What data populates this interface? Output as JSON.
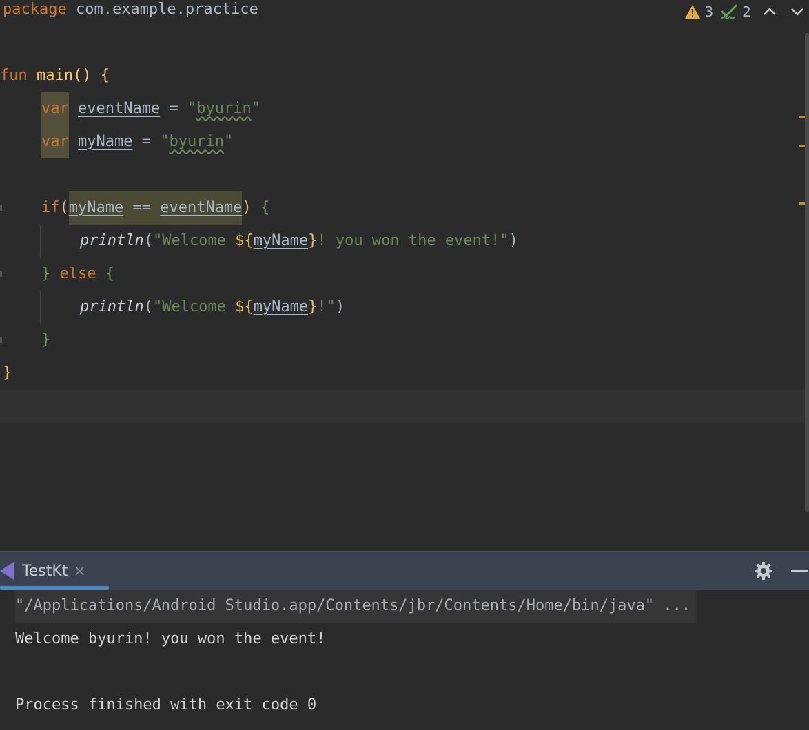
{
  "editor": {
    "package_keyword": "package",
    "package_name": "com.example.practice",
    "fun_keyword": "fun",
    "main_name": "main",
    "main_parens": "()",
    "open_brace": "{",
    "var_keyword": "var",
    "var1_name": "eventName",
    "var1_value": "\"byurin\"",
    "var2_name": "myName",
    "var2_value": "\"byurin\"",
    "equals": " = ",
    "if_keyword": "if",
    "cond_left": "myName",
    "cond_op": " == ",
    "cond_right": "eventName",
    "println_name": "println",
    "str1_prefix": "\"Welcome ",
    "tmpl_open": "${",
    "tmpl_var": "myName",
    "tmpl_close": "}",
    "str1_suffix": "! you won the event!\"",
    "str2_suffix": "!\"",
    "else_keyword": "else",
    "close_brace": "}"
  },
  "inspections": {
    "warnings_count": "3",
    "typos_count": "2",
    "warning_color": "#e0a93a",
    "typo_color": "#5fa05f"
  },
  "run_panel": {
    "tab_label": "TestKt",
    "close_glyph": "×",
    "command": "\"/Applications/Android Studio.app/Contents/jbr/Contents/Home/bin/java\" ...",
    "output": "Welcome byurin! you won the event!",
    "exit_message": "Process finished with exit code 0"
  }
}
